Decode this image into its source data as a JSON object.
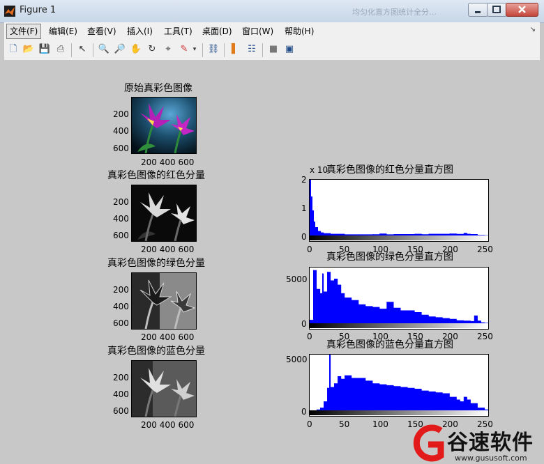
{
  "window": {
    "title": "Figure 1",
    "ghost_title": "均匀化直方图统计全分…"
  },
  "menu": [
    {
      "label": "文件(F)"
    },
    {
      "label": "编辑(E)"
    },
    {
      "label": "查看(V)"
    },
    {
      "label": "插入(I)"
    },
    {
      "label": "工具(T)"
    },
    {
      "label": "桌面(D)"
    },
    {
      "label": "窗口(W)"
    },
    {
      "label": "帮助(H)"
    }
  ],
  "toolbar_icons": [
    "new-figure-icon",
    "open-file-icon",
    "save-icon",
    "print-icon",
    "edit-plot-arrow-icon",
    "zoom-in-icon",
    "zoom-out-icon",
    "pan-hand-icon",
    "rotate-3d-icon",
    "data-cursor-icon",
    "brush-icon",
    "brush-dropdown-icon",
    "link-plot-icon",
    "colorbar-icon",
    "legend-icon",
    "hide-plot-tools-icon",
    "show-plot-tools-icon"
  ],
  "images": [
    {
      "title": "原始真彩色图像",
      "yticks": [
        "200",
        "400",
        "600"
      ],
      "xticks": "200 400 600",
      "kind": "color"
    },
    {
      "title": "真彩色图像的红色分量",
      "yticks": [
        "200",
        "400",
        "600"
      ],
      "xticks": "200 400 600",
      "kind": "red"
    },
    {
      "title": "真彩色图像的绿色分量",
      "yticks": [
        "200",
        "400",
        "600"
      ],
      "xticks": "200 400 600",
      "kind": "green"
    },
    {
      "title": "真彩色图像的蓝色分量",
      "yticks": [
        "200",
        "400",
        "600"
      ],
      "xticks": "200 400 600",
      "kind": "blue"
    }
  ],
  "histograms": [
    {
      "title": "真彩色图像的红色分量直方图",
      "exponent": "x 10",
      "yticks": [
        "2",
        "1",
        "0"
      ],
      "xticks": [
        "0",
        "50",
        "100",
        "150",
        "200",
        "250"
      ]
    },
    {
      "title": "真彩色图像的绿色分量直方图",
      "yticks": [
        "5000",
        "0"
      ],
      "xticks": [
        "0",
        "50",
        "100",
        "150",
        "200",
        "250"
      ]
    },
    {
      "title": "真彩色图像的蓝色分量直方图",
      "yticks": [
        "5000",
        "0"
      ],
      "xticks": [
        "0",
        "50",
        "100",
        "150",
        "200",
        "250"
      ]
    }
  ],
  "chart_data": [
    {
      "type": "bar",
      "title": "真彩色图像的红色分量直方图",
      "xlim": [
        0,
        255
      ],
      "ylim": [
        0,
        20000
      ],
      "x": [
        0,
        2,
        4,
        6,
        8,
        12,
        16,
        20,
        30,
        50,
        70,
        90,
        100,
        110,
        120,
        150,
        160,
        170,
        200,
        210,
        220,
        225,
        230,
        240,
        250
      ],
      "values": [
        20000,
        14000,
        9000,
        5000,
        3000,
        1600,
        1100,
        800,
        600,
        400,
        400,
        450,
        700,
        400,
        500,
        600,
        450,
        600,
        700,
        550,
        900,
        600,
        500,
        200,
        100
      ]
    },
    {
      "type": "bar",
      "title": "真彩色图像的绿色分量直方图",
      "xlim": [
        0,
        255
      ],
      "ylim": [
        0,
        6500
      ],
      "x": [
        0,
        5,
        10,
        15,
        18,
        20,
        25,
        30,
        35,
        40,
        45,
        50,
        60,
        70,
        80,
        90,
        100,
        110,
        120,
        130,
        140,
        150,
        160,
        170,
        180,
        190,
        200,
        210,
        220,
        230,
        235,
        240,
        245,
        250
      ],
      "values": [
        400,
        6200,
        4000,
        3500,
        5800,
        3700,
        6000,
        5000,
        5200,
        4500,
        3500,
        3000,
        2700,
        2200,
        2000,
        1900,
        1700,
        2500,
        1800,
        1500,
        1500,
        1300,
        1000,
        800,
        700,
        600,
        500,
        350,
        300,
        250,
        900,
        300,
        100,
        50
      ]
    },
    {
      "type": "bar",
      "title": "真彩色图像的蓝色分量直方图",
      "xlim": [
        0,
        255
      ],
      "ylim": [
        0,
        6200
      ],
      "x": [
        0,
        5,
        10,
        15,
        20,
        25,
        28,
        30,
        35,
        40,
        45,
        50,
        60,
        70,
        80,
        90,
        100,
        110,
        120,
        130,
        140,
        150,
        160,
        170,
        180,
        190,
        200,
        210,
        215,
        220,
        225,
        230,
        240,
        250
      ],
      "values": [
        0,
        0,
        100,
        300,
        1000,
        2500,
        6200,
        2600,
        3000,
        3800,
        3500,
        3900,
        3600,
        3600,
        3300,
        3000,
        2900,
        2800,
        2700,
        2600,
        2500,
        2400,
        2200,
        2100,
        2000,
        1900,
        1500,
        1200,
        1000,
        1500,
        1200,
        800,
        300,
        100
      ]
    }
  ],
  "watermark": {
    "brand": "谷速软件",
    "url": "www.gususoft.com"
  }
}
